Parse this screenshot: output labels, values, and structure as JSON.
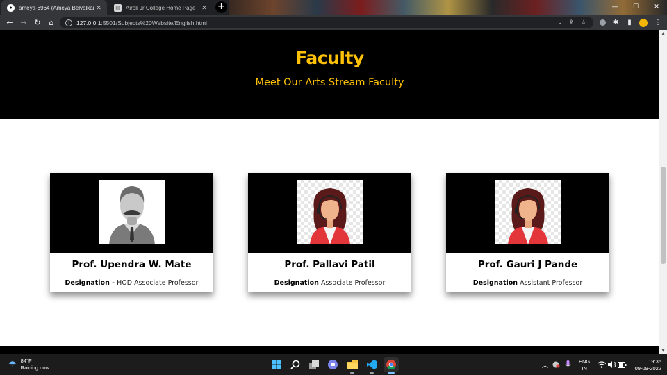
{
  "browser": {
    "tabs": [
      {
        "title": "ameya-6964 (Ameya Belvalkar)",
        "favicon": "github-icon",
        "active": true
      },
      {
        "title": "Airoli Jr College Home Page",
        "favicon": "page-icon",
        "active": false
      }
    ],
    "new_tab_label": "+",
    "close_glyph": "✕",
    "url": {
      "host": "127.0.0.1",
      "path": ":5501/Subjects%20Website/English.html"
    }
  },
  "page": {
    "heading": "Faculty",
    "subheading": "Meet Our Arts Stream Faculty",
    "accent_color": "#ffc107",
    "faculty": [
      {
        "name": "Prof. Upendra W. Mate",
        "designation_label": "Designation -",
        "designation": "HOD,Associate Professor",
        "avatar": "male-avatar-icon"
      },
      {
        "name": "Prof. Pallavi Patil",
        "designation_label": "Designation",
        "designation": "Associate Professor",
        "avatar": "female-avatar-icon"
      },
      {
        "name": "Prof. Gauri J Pande",
        "designation_label": "Designation",
        "designation": "Assistant Professor",
        "avatar": "female-avatar-icon"
      }
    ]
  },
  "taskbar": {
    "weather": {
      "temp": "84°F",
      "condition": "Raining now"
    },
    "language": {
      "line1": "ENG",
      "line2": "IN"
    },
    "clock": {
      "time": "19:35",
      "date": "09-09-2022"
    }
  }
}
